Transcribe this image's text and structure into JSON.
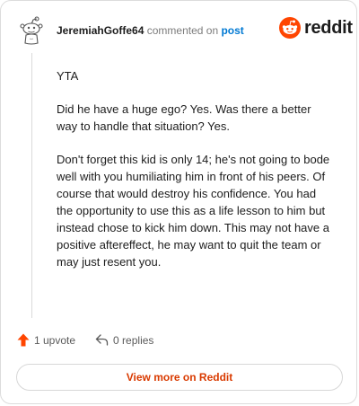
{
  "comment": {
    "username": "JeremiahGoffe64",
    "action_text": "commented on",
    "post_link": "post",
    "paragraphs": [
      "YTA",
      "Did he have a huge ego? Yes. Was there a better way to handle that situation? Yes.",
      "Don't forget this kid is only 14; he's not going to bode well with you humiliating him in front of his peers. Of course that would destroy his confidence. You had the opportunity to use this as a life lesson to him but instead chose to kick him down. This may not have a positive aftereffect, he may want to quit the team or may just resent you."
    ]
  },
  "brand": {
    "name": "reddit",
    "logo_icon": "reddit-snoo-icon",
    "accent_color": "#ff4500"
  },
  "stats": {
    "upvotes": "1 upvote",
    "upvote_icon": "upvote-arrow-icon",
    "upvote_color": "#ff4500",
    "replies": "0 replies",
    "reply_icon": "reply-arrow-icon"
  },
  "view_more_label": "View more on Reddit",
  "colors": {
    "link": "#0079d3",
    "view_more_text": "#d93a00",
    "border": "#dcdcdc"
  }
}
